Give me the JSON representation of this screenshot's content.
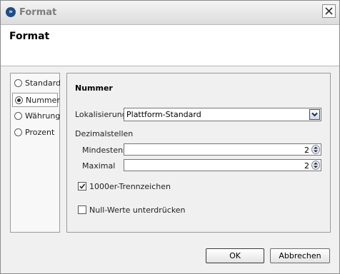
{
  "window": {
    "title": "Format",
    "header_title": "Format"
  },
  "sidebar": {
    "options": [
      {
        "label": "Standard",
        "selected": false
      },
      {
        "label": "Nummer",
        "selected": true
      },
      {
        "label": "Währung",
        "selected": false
      },
      {
        "label": "Prozent",
        "selected": false
      }
    ]
  },
  "main": {
    "section_title": "Nummer",
    "localization_label": "Lokalisierung",
    "localization_value": "Plattform-Standard",
    "decimals_label": "Dezimalstellen",
    "min_label": "Mindestens",
    "min_value": "2",
    "max_label": "Maximal",
    "max_value": "2",
    "thousands_label": "1000er-Trennzeichen",
    "thousands_checked": true,
    "suppress_label": "Null-Werte unterdrücken",
    "suppress_checked": false
  },
  "buttons": {
    "ok": "OK",
    "cancel": "Abbrechen"
  }
}
